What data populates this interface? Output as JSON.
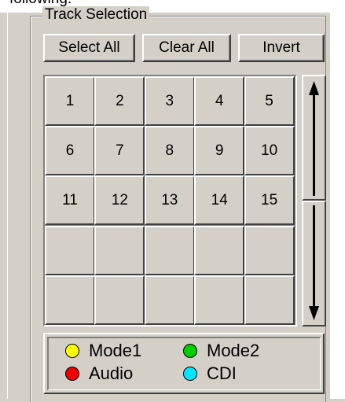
{
  "top_cut_text": "following:",
  "group": {
    "title": "Track Selection"
  },
  "buttons": {
    "select_all": "Select All",
    "clear_all": "Clear All",
    "invert": "Invert"
  },
  "tracks": [
    "1",
    "2",
    "3",
    "4",
    "5",
    "6",
    "7",
    "8",
    "9",
    "10",
    "11",
    "12",
    "13",
    "14",
    "15",
    "",
    "",
    "",
    "",
    "",
    "",
    "",
    "",
    "",
    ""
  ],
  "scroll": {
    "up_icon": "up-arrow-icon",
    "down_icon": "down-arrow-icon"
  },
  "legend": [
    {
      "label": "Mode1",
      "color": "#ffff00"
    },
    {
      "label": "Mode2",
      "color": "#00cc00"
    },
    {
      "label": "Audio",
      "color": "#ee0000"
    },
    {
      "label": "CDI",
      "color": "#00e5ff"
    }
  ]
}
